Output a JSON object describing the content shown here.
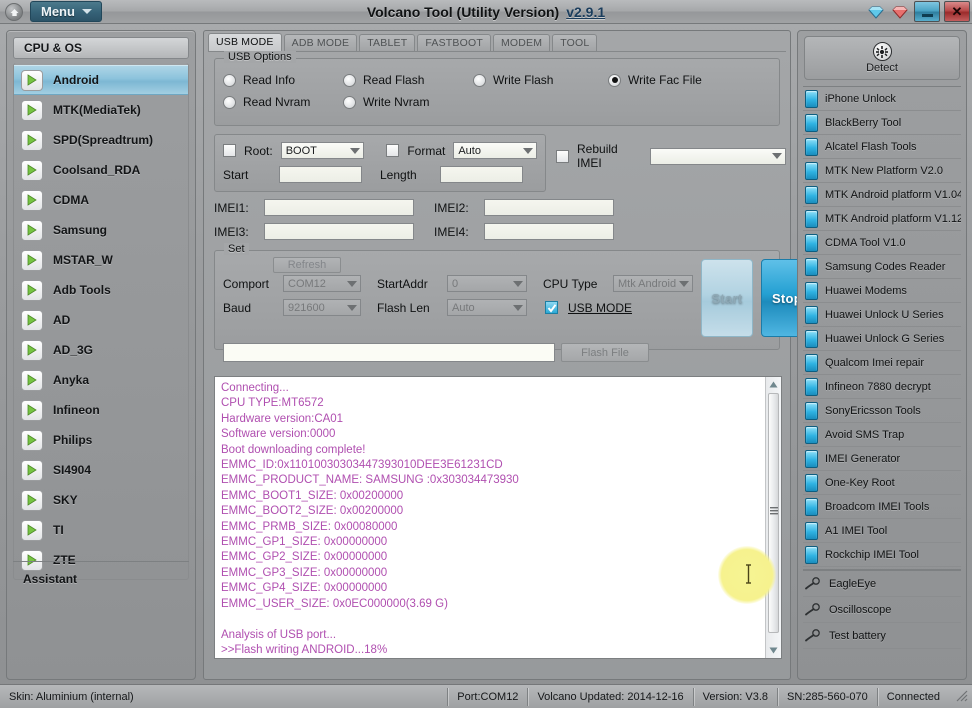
{
  "window": {
    "title": "Volcano Tool (Utility Version)",
    "version_link": "v2.9.1",
    "menu_label": "Menu",
    "home_icon": "home-icon",
    "gem_blue_icon": "blue-diamond-icon",
    "gem_red_icon": "red-diamond-icon",
    "minimize_label": "",
    "close_label": "✕"
  },
  "sidebar": {
    "header": "CPU & OS",
    "footer": "Assistant",
    "items": [
      {
        "label": "Android",
        "selected": true
      },
      {
        "label": "MTK(MediaTek)",
        "selected": false
      },
      {
        "label": "SPD(Spreadtrum)",
        "selected": false
      },
      {
        "label": "Coolsand_RDA",
        "selected": false
      },
      {
        "label": "CDMA",
        "selected": false
      },
      {
        "label": "Samsung",
        "selected": false
      },
      {
        "label": "MSTAR_W",
        "selected": false
      },
      {
        "label": "Adb Tools",
        "selected": false
      },
      {
        "label": "AD",
        "selected": false
      },
      {
        "label": "AD_3G",
        "selected": false
      },
      {
        "label": "Anyka",
        "selected": false
      },
      {
        "label": "Infineon",
        "selected": false
      },
      {
        "label": "Philips",
        "selected": false
      },
      {
        "label": "SI4904",
        "selected": false
      },
      {
        "label": "SKY",
        "selected": false
      },
      {
        "label": "TI",
        "selected": false
      },
      {
        "label": "ZTE",
        "selected": false
      }
    ]
  },
  "tabs": [
    {
      "label": "USB MODE",
      "active": true
    },
    {
      "label": "ADB MODE",
      "active": false
    },
    {
      "label": "TABLET",
      "active": false
    },
    {
      "label": "FASTBOOT",
      "active": false
    },
    {
      "label": "MODEM",
      "active": false
    },
    {
      "label": "TOOL",
      "active": false
    }
  ],
  "usb_options": {
    "legend": "USB Options",
    "radios": [
      {
        "label": "Read Info",
        "checked": false
      },
      {
        "label": "Read Flash",
        "checked": false
      },
      {
        "label": "Write Flash",
        "checked": false
      },
      {
        "label": "Write Fac File",
        "checked": true
      },
      {
        "label": "Read Nvram",
        "checked": false
      },
      {
        "label": "Write Nvram",
        "checked": false
      }
    ]
  },
  "root_group": {
    "root_check_label": "Root:",
    "root_value": "BOOT",
    "root_checked": false,
    "format_check_label": "Format",
    "format_value": "Auto",
    "format_checked": false,
    "start_label": "Start",
    "start_value": "",
    "length_label": "Length",
    "length_value": ""
  },
  "rebuild": {
    "label": "Rebuild IMEI",
    "checked": false,
    "value": ""
  },
  "imei": [
    {
      "label": "IMEI1:",
      "value": ""
    },
    {
      "label": "IMEI2:",
      "value": ""
    },
    {
      "label": "IMEI3:",
      "value": ""
    },
    {
      "label": "IMEI4:",
      "value": ""
    }
  ],
  "set_group": {
    "legend": "Set",
    "refresh_label": "Refresh",
    "comport_label": "Comport",
    "comport_value": "COM12",
    "startaddr_label": "StartAddr",
    "startaddr_value": "0",
    "cputype_label": "CPU Type",
    "cputype_value": "Mtk Android",
    "baud_label": "Baud",
    "baud_value": "921600",
    "flashlen_label": "Flash Len",
    "flashlen_value": "Auto",
    "usbmode_label": "USB MODE",
    "usbmode_checked": true,
    "start_button": "Start",
    "stop_button": "Stop",
    "flash_file_value": "",
    "flash_file_button": "Flash File"
  },
  "log": {
    "text": "Connecting...\nCPU TYPE:MT6572\nHardware version:CA01\nSoftware version:0000\nBoot downloading complete!\nEMMC_ID:0x11010030303447393010DEE3E61231CD\nEMMC_PRODUCT_NAME: SAMSUNG :0x303034473930\nEMMC_BOOT1_SIZE: 0x00200000\nEMMC_BOOT2_SIZE: 0x00200000\nEMMC_PRMB_SIZE: 0x00080000\nEMMC_GP1_SIZE: 0x00000000\nEMMC_GP2_SIZE: 0x00000000\nEMMC_GP3_SIZE: 0x00000000\nEMMC_GP4_SIZE: 0x00000000\nEMMC_USER_SIZE: 0x0EC000000(3.69 G)\n\nAnalysis of USB port...\n>>Flash writing ANDROID...18%",
    "color": "#b04fb0"
  },
  "progress": {
    "percent": 18,
    "accent": "#22b6e2"
  },
  "right_panel": {
    "detect_label": "Detect",
    "detect_icon": "gear-icon",
    "items": [
      {
        "label": "iPhone Unlock",
        "icon": "blue-phone-icon"
      },
      {
        "label": "BlackBerry Tool",
        "icon": "blue-phone-icon"
      },
      {
        "label": "Alcatel Flash Tools",
        "icon": "blue-phone-icon"
      },
      {
        "label": "MTK New Platform V2.0",
        "icon": "blue-phone-icon"
      },
      {
        "label": "MTK Android platform V1.04",
        "icon": "blue-phone-icon"
      },
      {
        "label": "MTK Android platform V1.12",
        "icon": "blue-phone-icon"
      },
      {
        "label": "CDMA Tool  V1.0",
        "icon": "blue-phone-icon"
      },
      {
        "label": "Samsung Codes Reader",
        "icon": "blue-phone-icon"
      },
      {
        "label": "Huawei Modems",
        "icon": "blue-phone-icon"
      },
      {
        "label": "Huawei Unlock U Series",
        "icon": "blue-phone-icon"
      },
      {
        "label": "Huawei Unlock G Series",
        "icon": "blue-phone-icon"
      },
      {
        "label": "Qualcom Imei repair",
        "icon": "blue-phone-icon"
      },
      {
        "label": "Infineon 7880 decrypt",
        "icon": "blue-phone-icon"
      },
      {
        "label": "SonyEricsson Tools",
        "icon": "blue-phone-icon"
      },
      {
        "label": "Avoid SMS Trap",
        "icon": "blue-phone-icon"
      },
      {
        "label": "IMEI Generator",
        "icon": "blue-phone-icon"
      },
      {
        "label": "One-Key Root",
        "icon": "blue-phone-icon"
      },
      {
        "label": "Broadcom IMEI Tools",
        "icon": "blue-phone-icon"
      },
      {
        "label": "A1 IMEI Tool",
        "icon": "blue-phone-icon"
      },
      {
        "label": "Rockchip IMEI Tool",
        "icon": "blue-phone-icon"
      }
    ],
    "tools": [
      {
        "label": "EagleEye",
        "icon": "probe-icon"
      },
      {
        "label": "Oscilloscope",
        "icon": "probe-icon"
      },
      {
        "label": "Test battery",
        "icon": "probe-icon"
      }
    ]
  },
  "statusbar": {
    "skin": "Skin: Aluminium (internal)",
    "port": "Port:COM12",
    "updated": "Volcano Updated: 2014-12-16",
    "version": "Version: V3.8",
    "sn": "SN:285-560-070",
    "connection": "Connected"
  }
}
